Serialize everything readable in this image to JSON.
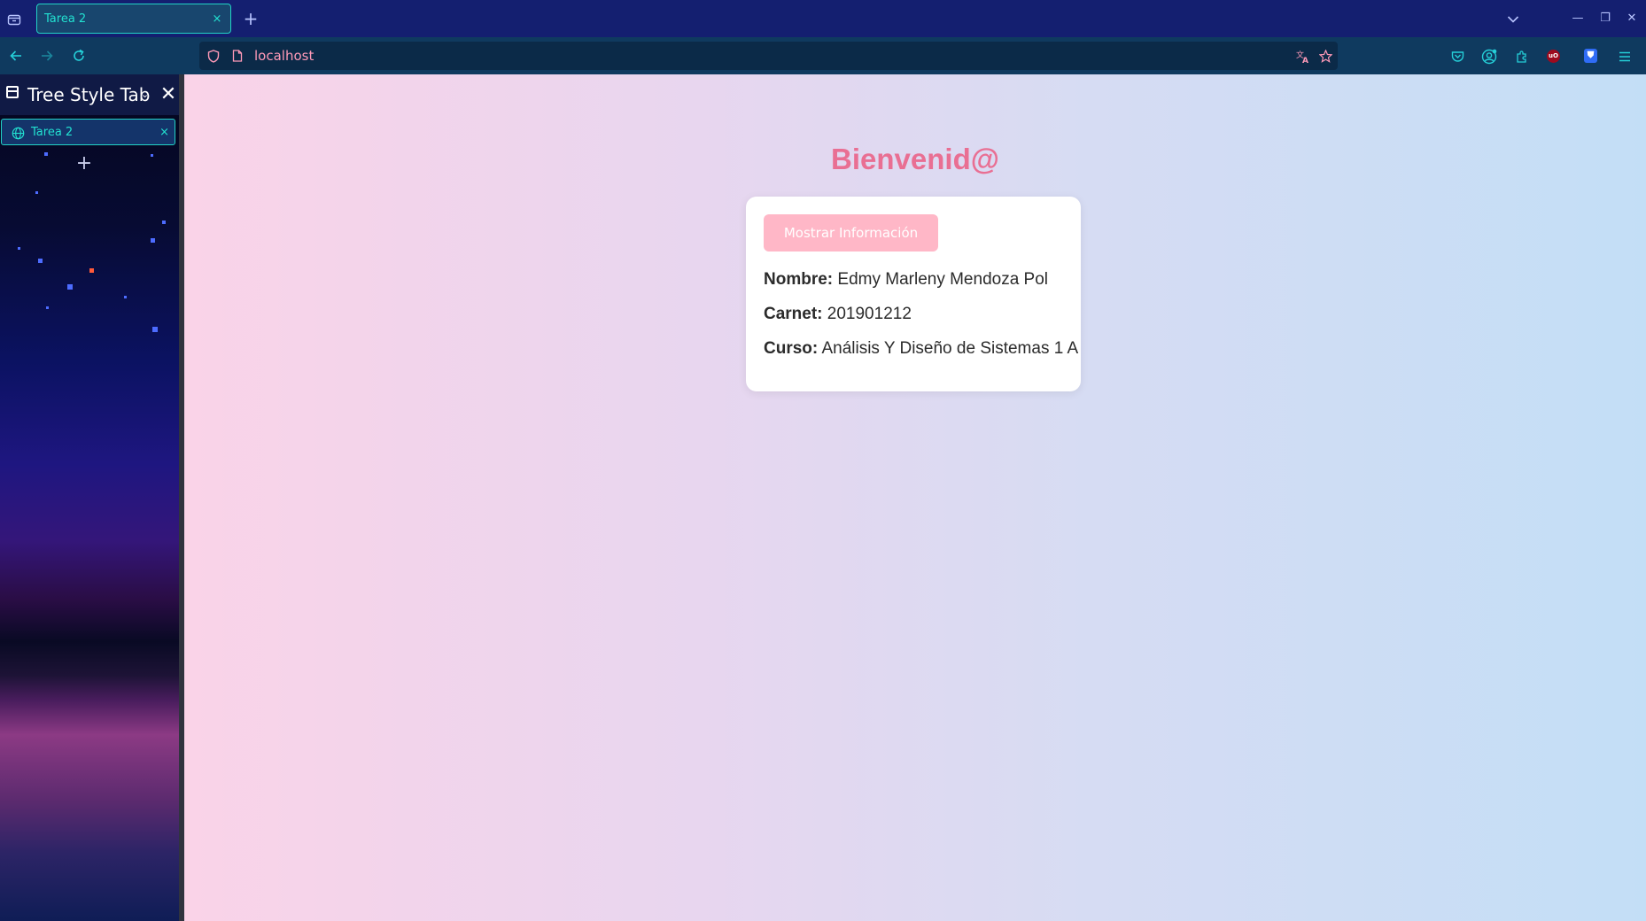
{
  "browser": {
    "tab_title": "Tarea 2",
    "tab_close": "×",
    "new_tab": "+",
    "url": "localhost",
    "window_controls": {
      "minimize": "—",
      "restore": "❐",
      "close": "✕"
    }
  },
  "sidebar": {
    "title": "Tree Style Tab",
    "chevron": "⌄",
    "close": "✕",
    "tab_title": "Tarea 2",
    "tab_close": "×",
    "new_tab": "+"
  },
  "page": {
    "heading": "Bienvenid@",
    "button_label": "Mostrar Información",
    "fields": [
      {
        "label": "Nombre:",
        "value": " Edmy Marleny Mendoza Pol"
      },
      {
        "label": "Carnet:",
        "value": " 201901212"
      },
      {
        "label": "Curso:",
        "value": " Análisis Y Diseño de Sistemas 1 A"
      }
    ]
  },
  "colors": {
    "heading": "#e96f93",
    "button_bg": "#ffb7c7",
    "tab_accent": "#22d3c5",
    "toolbar_bg": "#141f70",
    "url_text": "#ff9ab8"
  },
  "icons": {
    "tab_list": "tab-list-icon",
    "back": "back-arrow-icon",
    "forward": "forward-arrow-icon",
    "reload": "reload-icon",
    "shield": "tracking-protection-shield-icon",
    "page": "page-icon",
    "translate": "translate-icon",
    "bookmark": "star-bookmark-icon",
    "pocket": "pocket-icon",
    "account": "account-icon",
    "extensions": "puzzle-extensions-icon",
    "ublock": "ublock-icon",
    "bitwarden": "bitwarden-shield-icon",
    "menu": "hamburger-menu-icon",
    "list_tabs": "list-all-tabs-chevron-icon"
  }
}
